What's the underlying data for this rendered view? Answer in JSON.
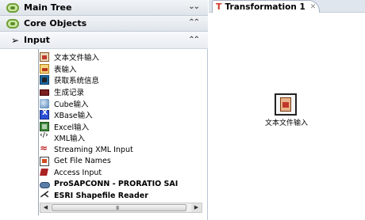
{
  "left_panel": {
    "main_tree_label": "Main Tree",
    "core_objects_label": "Core Objects",
    "input_category_label": "Input",
    "items": [
      {
        "label": "文本文件输入",
        "icon": "text-file-input-icon",
        "bold": false
      },
      {
        "label": "表输入",
        "icon": "table-input-icon",
        "bold": false
      },
      {
        "label": "获取系统信息",
        "icon": "system-info-icon",
        "bold": false
      },
      {
        "label": "生成记录",
        "icon": "generate-rows-icon",
        "bold": false
      },
      {
        "label": "Cube输入",
        "icon": "cube-input-icon",
        "bold": false
      },
      {
        "label": "XBase输入",
        "icon": "xbase-input-icon",
        "bold": false
      },
      {
        "label": "Excel输入",
        "icon": "excel-input-icon",
        "bold": false
      },
      {
        "label": "XML输入",
        "icon": "xml-input-icon",
        "bold": false
      },
      {
        "label": "Streaming XML Input",
        "icon": "streaming-xml-icon",
        "bold": false
      },
      {
        "label": "Get File Names",
        "icon": "get-file-names-icon",
        "bold": false
      },
      {
        "label": "Access Input",
        "icon": "access-input-icon",
        "bold": false
      },
      {
        "label": "ProSAPCONN - PRORATIO SAI",
        "icon": "sap-connector-icon",
        "bold": true
      },
      {
        "label": "ESRI Shapefile Reader",
        "icon": "esri-shapefile-icon",
        "bold": true
      }
    ],
    "scroll_grip": "III"
  },
  "right_panel": {
    "tab_title": "Transformation 1",
    "tab_close": "✕",
    "step_label": "文本文件输入"
  }
}
